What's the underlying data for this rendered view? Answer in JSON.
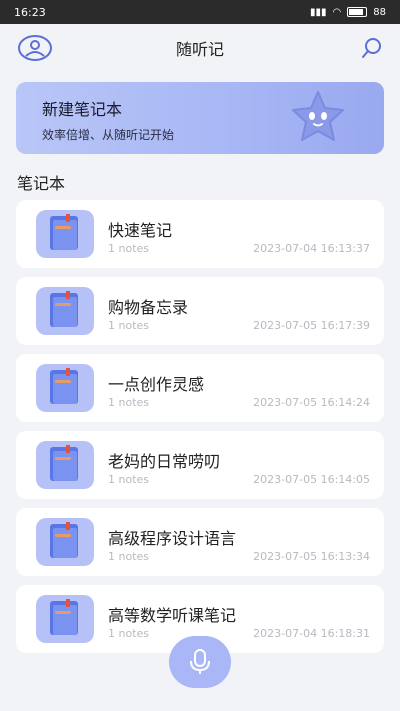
{
  "status_bar": {
    "time": "16:23",
    "battery": "88"
  },
  "header": {
    "title": "随听记"
  },
  "banner": {
    "title": "新建笔记本",
    "subtitle": "效率倍增、从随听记开始"
  },
  "section": {
    "title": "笔记本"
  },
  "notes": [
    {
      "name": "快速笔记",
      "count": "1 notes",
      "date": "2023-07-04 16:13:37"
    },
    {
      "name": "购物备忘录",
      "count": "1 notes",
      "date": "2023-07-05 16:17:39"
    },
    {
      "name": "一点创作灵感",
      "count": "1 notes",
      "date": "2023-07-05 16:14:24"
    },
    {
      "name": "老妈的日常唠叨",
      "count": "1 notes",
      "date": "2023-07-05 16:14:05"
    },
    {
      "name": "高级程序设计语言",
      "count": "1 notes",
      "date": "2023-07-05 16:13:34"
    },
    {
      "name": "高等数学听课笔记",
      "count": "1 notes",
      "date": "2023-07-04 16:18:31"
    }
  ],
  "icons": {
    "avatar": "user-icon",
    "search": "search-icon",
    "notebook": "notebook-icon",
    "mic": "microphone-icon",
    "mascot": "star-mascot"
  },
  "colors": {
    "accent": "#a7b6f5",
    "background": "#f2f3f7",
    "card": "#ffffff"
  }
}
